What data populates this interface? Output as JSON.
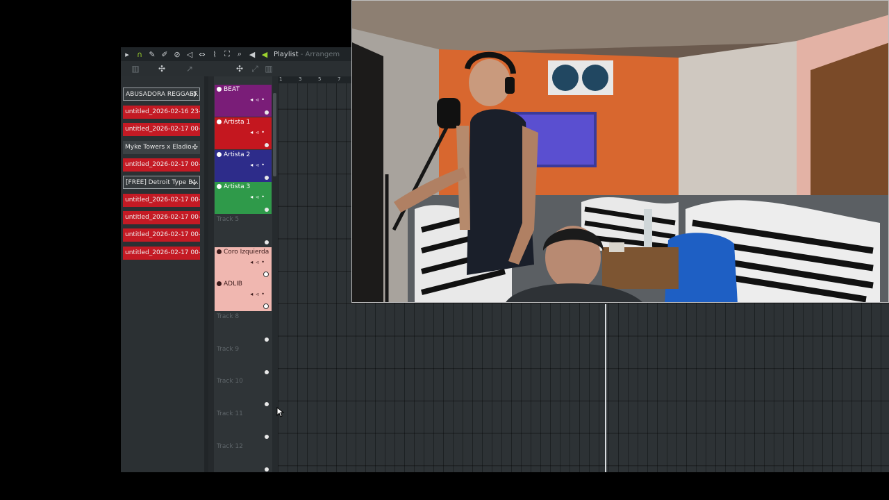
{
  "toolbar": {
    "title": "Playlist",
    "subtitle": " - Arrangem"
  },
  "ruler": {
    "labels": [
      "1",
      "3",
      "5",
      "7"
    ]
  },
  "clips": [
    {
      "label": "ABUSADORA REGGAET...",
      "kind": "pattern"
    },
    {
      "label": "untitled_2026-02-16 23-...",
      "kind": "audio"
    },
    {
      "label": "untitled_2026-02-17 00-...",
      "kind": "audio"
    },
    {
      "label": "Myke Towers x Eladio...",
      "kind": "pattern"
    },
    {
      "label": "untitled_2026-02-17 00-...",
      "kind": "audio"
    },
    {
      "label": "[FREE] Detroit Type B...",
      "kind": "pattern"
    },
    {
      "label": "untitled_2026-02-17 00-...",
      "kind": "audio"
    },
    {
      "label": "untitled_2026-02-17 00-...",
      "kind": "audio"
    },
    {
      "label": "untitled_2026-02-17 00-...",
      "kind": "audio"
    },
    {
      "label": "untitled_2026-02-17 00-...",
      "kind": "audio"
    }
  ],
  "tracks": [
    {
      "name": "BEAT",
      "color": "#7a1d78"
    },
    {
      "name": "Artista 1",
      "color": "#c4171f"
    },
    {
      "name": "Artista 2",
      "color": "#2d2c8a"
    },
    {
      "name": "Artista 3",
      "color": "#2f9a4a"
    },
    {
      "name": "Track 5",
      "color": ""
    },
    {
      "name": "Coro Izquierda",
      "color": "#f0b7b0"
    },
    {
      "name": "ADLIB",
      "color": "#f0b7b0"
    },
    {
      "name": "Track 8",
      "color": ""
    },
    {
      "name": "Track 9",
      "color": ""
    },
    {
      "name": "Track 10",
      "color": ""
    },
    {
      "name": "Track 11",
      "color": ""
    },
    {
      "name": "Track 12",
      "color": ""
    }
  ],
  "colors": {
    "audio_clip": "#c41a24",
    "accent": "#9bd12e"
  }
}
